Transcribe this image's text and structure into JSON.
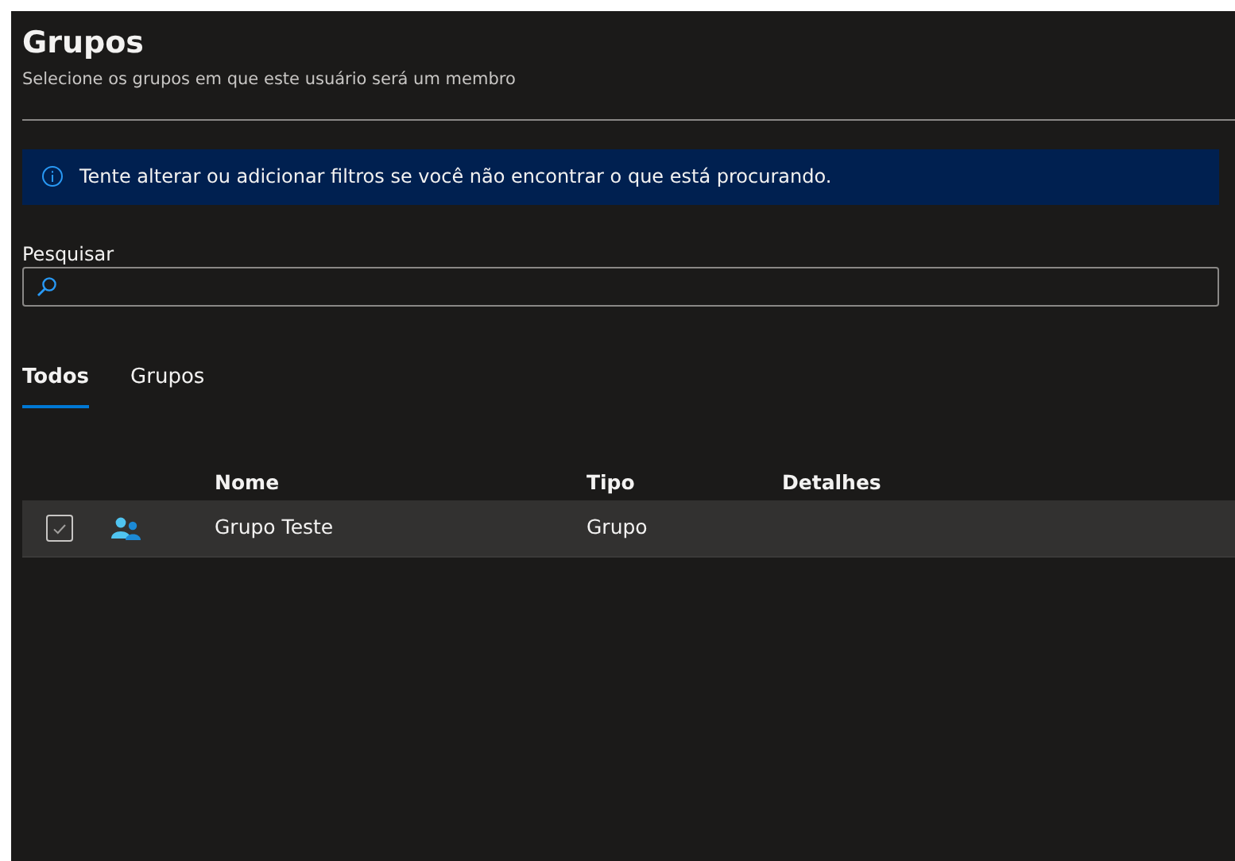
{
  "header": {
    "title": "Grupos",
    "subtitle": "Selecione os grupos em que este usuário será um membro"
  },
  "info_bar": {
    "text": "Tente alterar ou adicionar filtros se você não encontrar o que está procurando."
  },
  "search": {
    "label": "Pesquisar"
  },
  "tabs": [
    {
      "label": "Todos",
      "selected": true
    },
    {
      "label": "Grupos",
      "selected": false
    }
  ],
  "table": {
    "columns": [
      "Nome",
      "Tipo",
      "Detalhes"
    ],
    "rows": [
      {
        "name": "Grupo Teste",
        "type": "Grupo",
        "checked": true,
        "selected": true
      }
    ]
  }
}
